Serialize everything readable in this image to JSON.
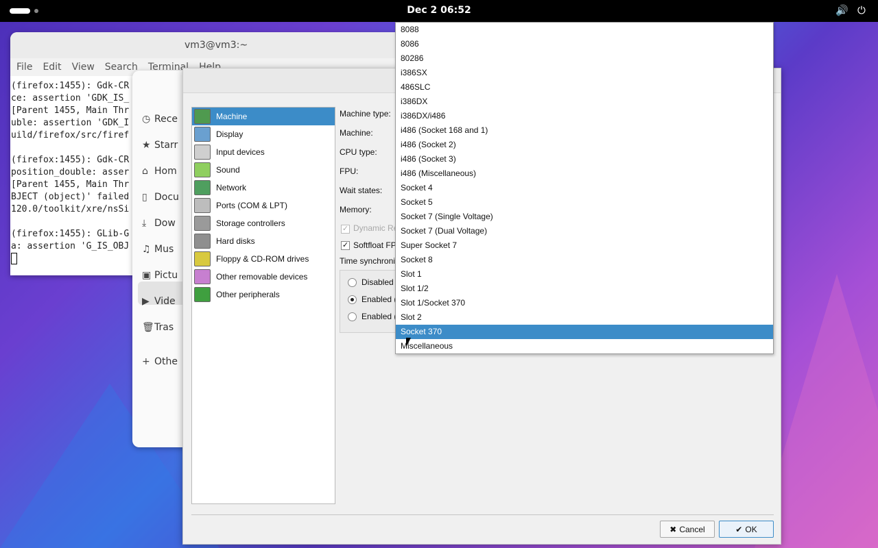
{
  "topbar": {
    "clock": "Dec 2  06:52",
    "volume_icon": "volume-icon",
    "power_icon": "power-icon"
  },
  "terminal": {
    "title": "vm3@vm3:~",
    "menu": [
      "File",
      "Edit",
      "View",
      "Search",
      "Terminal",
      "Help"
    ],
    "lines": [
      "(firefox:1455): Gdk-CR",
      "ce: assertion 'GDK_IS_",
      "[Parent 1455, Main Thr",
      "uble: assertion 'GDK_I",
      "uild/firefox/src/firef",
      "",
      "(firefox:1455): Gdk-CR",
      "position_double: asser",
      "[Parent 1455, Main Thr",
      "BJECT (object)' failed",
      "120.0/toolkit/xre/nsSi",
      "",
      "(firefox:1455): GLib-G",
      "a: assertion 'G_IS_OBJ"
    ]
  },
  "files": {
    "items": [
      {
        "icon": "clock-icon",
        "glyph": "◷",
        "label": "Rece"
      },
      {
        "icon": "star-icon",
        "glyph": "★",
        "label": "Starr"
      },
      {
        "icon": "home-icon",
        "glyph": "⌂",
        "label": "Hom"
      },
      {
        "icon": "document-icon",
        "glyph": "▯",
        "label": "Docu"
      },
      {
        "icon": "download-icon",
        "glyph": "⤓",
        "label": "Dow"
      },
      {
        "icon": "music-icon",
        "glyph": "♫",
        "label": "Mus"
      },
      {
        "icon": "picture-icon",
        "glyph": "▣",
        "label": "Pictu"
      },
      {
        "icon": "video-icon",
        "glyph": "▶",
        "label": "Vide"
      },
      {
        "icon": "trash-icon",
        "glyph": "🗑",
        "label": "Tras"
      },
      {
        "icon": "plus-icon",
        "glyph": "+",
        "label": "Othe"
      }
    ]
  },
  "dialog": {
    "categories": [
      {
        "label": "Machine",
        "icon": "machine-icon",
        "color": "#4f9a4f"
      },
      {
        "label": "Display",
        "icon": "display-icon",
        "color": "#6aa0d0"
      },
      {
        "label": "Input devices",
        "icon": "input-devices-icon",
        "color": "#cfcfcf"
      },
      {
        "label": "Sound",
        "icon": "sound-icon",
        "color": "#8fcf5f"
      },
      {
        "label": "Network",
        "icon": "network-icon",
        "color": "#4f9f5f"
      },
      {
        "label": "Ports (COM & LPT)",
        "icon": "ports-icon",
        "color": "#bdbdbd"
      },
      {
        "label": "Storage controllers",
        "icon": "storage-icon",
        "color": "#9a9a9a"
      },
      {
        "label": "Hard disks",
        "icon": "hard-disk-icon",
        "color": "#8f8f8f"
      },
      {
        "label": "Floppy & CD-ROM drives",
        "icon": "floppy-cdrom-icon",
        "color": "#d8c93f"
      },
      {
        "label": "Other removable devices",
        "icon": "removable-icon",
        "color": "#c77fd0"
      },
      {
        "label": "Other peripherals",
        "icon": "peripherals-icon",
        "color": "#3f9f3f"
      }
    ],
    "selected_category": "Machine",
    "labels": {
      "machine_type": "Machine type:",
      "machine": "Machine:",
      "cpu_type": "CPU type:",
      "fpu": "FPU:",
      "wait_states": "Wait states:",
      "memory": "Memory:",
      "dynamic_recompiler": "Dynamic Re",
      "softfloat": "Softfloat FP",
      "time_sync": "Time synchroni",
      "disabled": "Disabled",
      "enabled_1": "Enabled (",
      "enabled_2": "Enabled ("
    },
    "softfloat_checked": "✓",
    "dynamic_checked": "✓",
    "buttons": {
      "cancel": "Cancel",
      "ok": "OK"
    }
  },
  "dropdown": {
    "items": [
      "8088",
      "8086",
      "80286",
      "i386SX",
      "486SLC",
      "i386DX",
      "i386DX/i486",
      "i486 (Socket 168 and 1)",
      "i486 (Socket 2)",
      "i486 (Socket 3)",
      "i486 (Miscellaneous)",
      "Socket 4",
      "Socket 5",
      "Socket 7 (Single Voltage)",
      "Socket 7 (Dual Voltage)",
      "Super Socket 7",
      "Socket 8",
      "Slot 1",
      "Slot 1/2",
      "Slot 1/Socket 370",
      "Slot 2",
      "Socket 370",
      "Miscellaneous"
    ],
    "selected": "Socket 370"
  }
}
